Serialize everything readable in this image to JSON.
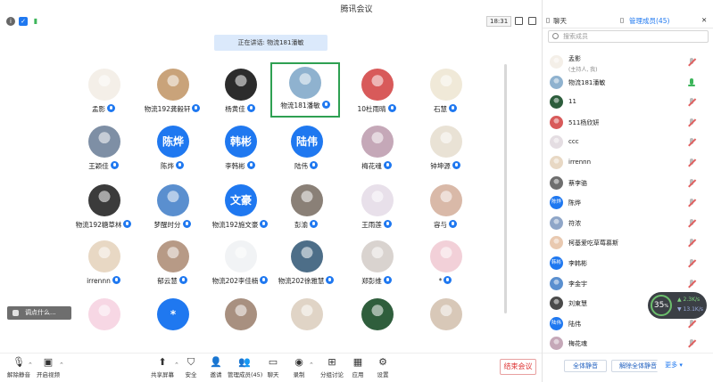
{
  "window": {
    "title": "腾讯会议"
  },
  "infobar": {
    "time": "18:31"
  },
  "speaker_banner": "正在讲话: 物流181潘敏",
  "grid": [
    {
      "name": "孟影",
      "avatar": "photo",
      "color": "#f4efe8"
    },
    {
      "name": "物流192龚毅轩",
      "avatar": "photo",
      "color": "#c9a37a"
    },
    {
      "name": "杨黄佳",
      "avatar": "photo",
      "color": "#2c2c2c"
    },
    {
      "name": "物流181潘敏",
      "avatar": "photo",
      "color": "#8fb2cf",
      "active": true
    },
    {
      "name": "10杜雨晴",
      "avatar": "photo",
      "color": "#d85a5a"
    },
    {
      "name": "石慧",
      "avatar": "photo",
      "color": "#f0e9d8"
    },
    {
      "name": "王颖佳",
      "avatar": "photo",
      "color": "#7e8fa5"
    },
    {
      "name": "陈烨",
      "avatar": "text",
      "text": "陈烨"
    },
    {
      "name": "李韩彬",
      "avatar": "text",
      "text": "韩彬"
    },
    {
      "name": "陆伟",
      "avatar": "text",
      "text": "陆伟"
    },
    {
      "name": "梅花魂",
      "avatar": "photo",
      "color": "#c5a8b8"
    },
    {
      "name": "钟坤源",
      "avatar": "photo",
      "color": "#e9e2d5"
    },
    {
      "name": "物流192糖草林",
      "avatar": "photo",
      "color": "#3b3b3b"
    },
    {
      "name": "梦醒时分",
      "avatar": "photo",
      "color": "#5a8fcf"
    },
    {
      "name": "物流192施文豪",
      "avatar": "text",
      "text": "文豪"
    },
    {
      "name": "彭渝",
      "avatar": "photo",
      "color": "#8a8077"
    },
    {
      "name": "王雨莲",
      "avatar": "photo",
      "color": "#e8e0ea"
    },
    {
      "name": "容与",
      "avatar": "photo",
      "color": "#d9b9a8"
    },
    {
      "name": "irrennn",
      "avatar": "photo",
      "color": "#e8d8c4"
    },
    {
      "name": "郁云慧",
      "avatar": "photo",
      "color": "#b79a86"
    },
    {
      "name": "物流202李佳楠",
      "avatar": "photo",
      "color": "#f1f3f5"
    },
    {
      "name": "物流202徐雅慧",
      "avatar": "photo",
      "color": "#4d6e88"
    },
    {
      "name": "郑彭维",
      "avatar": "photo",
      "color": "#d9d3cf"
    },
    {
      "name": "*",
      "avatar": "photo",
      "color": "#f2d0d8"
    },
    {
      "name": "",
      "avatar": "photo",
      "color": "#f7d7e4"
    },
    {
      "name": "",
      "avatar": "text",
      "text": "*"
    },
    {
      "name": "",
      "avatar": "photo",
      "color": "#a89080"
    },
    {
      "name": "",
      "avatar": "photo",
      "color": "#e0d4c6"
    },
    {
      "name": "",
      "avatar": "photo",
      "color": "#2f5e3c"
    },
    {
      "name": "",
      "avatar": "photo",
      "color": "#d8c8b8"
    }
  ],
  "toast": "调点什么...",
  "toolbar": {
    "unmute": "解除静音",
    "video": "开启视频",
    "share": "共享屏幕",
    "security": "安全",
    "invite": "邀请",
    "members": "管理成员(45)",
    "chat": "聊天",
    "record": "录制",
    "breakout": "分组讨论",
    "apps": "应用",
    "settings": "设置",
    "end": "结束会议"
  },
  "panel": {
    "tab_chat": "聊天",
    "tab_members": "管理成员(45)",
    "search_placeholder": "搜索成员",
    "members": [
      {
        "name": "孟影",
        "sub": "(主持人, 我)",
        "avatar": "photo",
        "color": "#f4efe8",
        "mic": "off"
      },
      {
        "name": "物流181潘敏",
        "avatar": "photo",
        "color": "#8fb2cf",
        "mic": "on"
      },
      {
        "name": "11",
        "avatar": "photo",
        "color": "#2d5d3c",
        "mic": "off"
      },
      {
        "name": "511杨欣妍",
        "avatar": "photo",
        "color": "#d85a5a",
        "mic": "off"
      },
      {
        "name": "ccc",
        "avatar": "photo",
        "color": "#e4dde2",
        "mic": "off"
      },
      {
        "name": "irrennn",
        "avatar": "photo",
        "color": "#e8d8c4",
        "mic": "off"
      },
      {
        "name": "蔡李骆",
        "avatar": "photo",
        "color": "#6e6e6e",
        "mic": "off"
      },
      {
        "name": "陈烨",
        "avatar": "text",
        "text": "陈烨",
        "mic": "off"
      },
      {
        "name": "符浓",
        "avatar": "photo",
        "color": "#8fa6c8",
        "mic": "off"
      },
      {
        "name": "柯基爱吃草莓慕斯",
        "avatar": "photo",
        "color": "#e9c9b0",
        "mic": "off"
      },
      {
        "name": "李韩彬",
        "avatar": "text",
        "text": "韩彬",
        "mic": "off"
      },
      {
        "name": "李金宇",
        "avatar": "photo",
        "color": "#5a8fcf",
        "mic": "off"
      },
      {
        "name": "刘東慧",
        "avatar": "photo",
        "color": "#4a4a4a",
        "mic": "off"
      },
      {
        "name": "陆伟",
        "avatar": "text",
        "text": "陆伟",
        "mic": "off"
      },
      {
        "name": "梅花魂",
        "avatar": "photo",
        "color": "#c5a8b8",
        "mic": "off"
      }
    ],
    "btn_mute_all": "全体静音",
    "btn_unmute_all": "解除全体静音",
    "btn_more": "更多"
  },
  "network": {
    "percent": "35",
    "percent_sign": "%",
    "up": "2.3K/s",
    "down": "13.1K/s"
  }
}
